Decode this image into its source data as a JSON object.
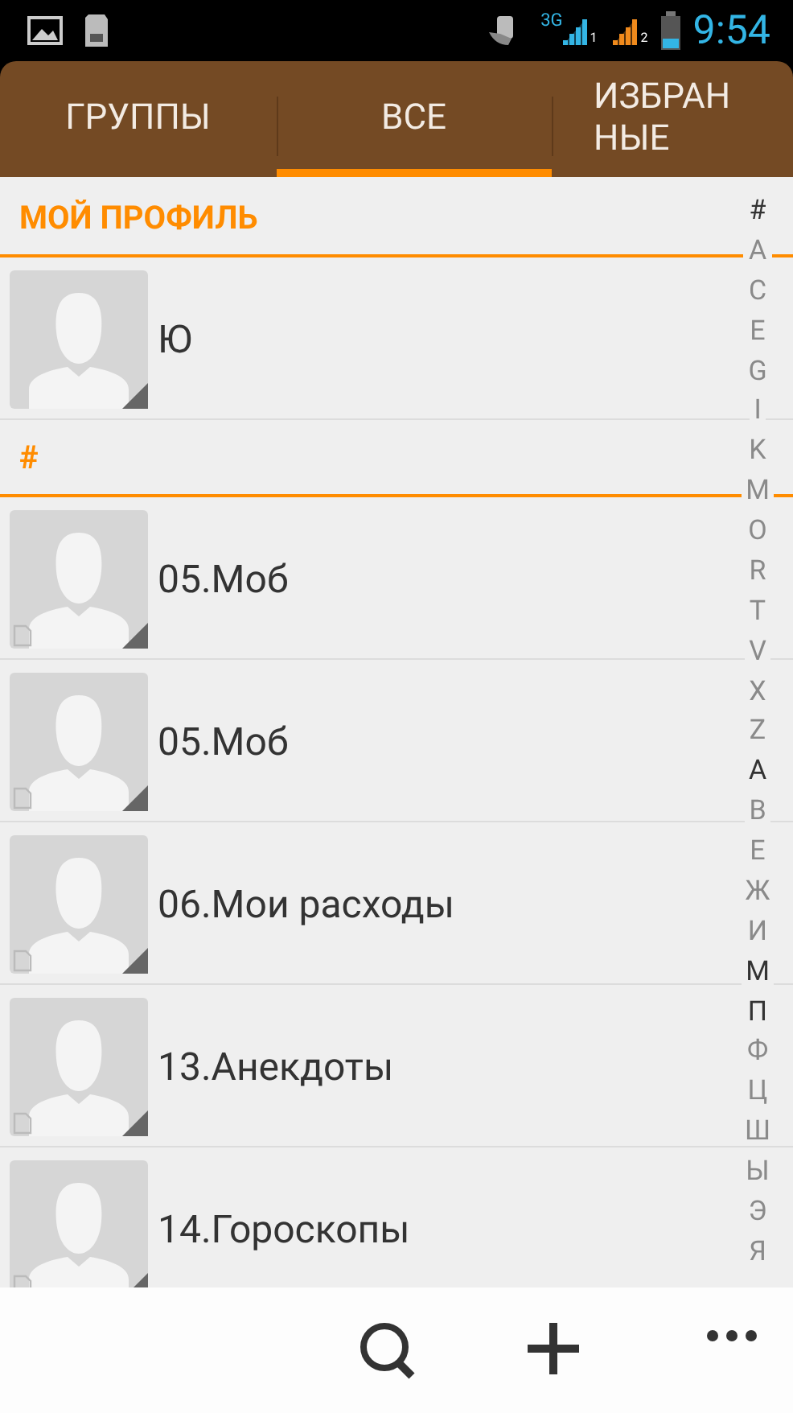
{
  "status_bar": {
    "network": "3G",
    "signals": [
      {
        "sim": "1",
        "color": "#33b5e5"
      },
      {
        "sim": "2",
        "color": "#f08a1c"
      }
    ],
    "time": "9:54"
  },
  "tabs": [
    {
      "label": "ГРУППЫ",
      "selected": false
    },
    {
      "label": "ВСЕ",
      "selected": true
    },
    {
      "label": "ИЗБРАН НЫЕ",
      "selected": false
    }
  ],
  "sections": [
    {
      "title": "МОЙ ПРОФИЛЬ",
      "contacts": [
        {
          "name": "Ю",
          "sim_badge": false
        }
      ]
    },
    {
      "title": "#",
      "contacts": [
        {
          "name": "05.Моб",
          "sim_badge": true
        },
        {
          "name": "05.Моб",
          "sim_badge": true
        },
        {
          "name": "06.Мои расходы",
          "sim_badge": true
        },
        {
          "name": "13.Анекдоты",
          "sim_badge": true
        },
        {
          "name": "14.Гороскопы",
          "sim_badge": true
        }
      ]
    }
  ],
  "index": [
    {
      "letter": "#",
      "active": true
    },
    {
      "letter": "A",
      "active": false
    },
    {
      "letter": "C",
      "active": false
    },
    {
      "letter": "E",
      "active": false
    },
    {
      "letter": "G",
      "active": false
    },
    {
      "letter": "I",
      "active": false
    },
    {
      "letter": "K",
      "active": false
    },
    {
      "letter": "M",
      "active": false
    },
    {
      "letter": "O",
      "active": false
    },
    {
      "letter": "R",
      "active": false
    },
    {
      "letter": "T",
      "active": false
    },
    {
      "letter": "V",
      "active": false
    },
    {
      "letter": "X",
      "active": false
    },
    {
      "letter": "Z",
      "active": false
    },
    {
      "letter": "А",
      "active": true
    },
    {
      "letter": "В",
      "active": false
    },
    {
      "letter": "Е",
      "active": false
    },
    {
      "letter": "Ж",
      "active": false
    },
    {
      "letter": "И",
      "active": false
    },
    {
      "letter": "М",
      "active": true
    },
    {
      "letter": "П",
      "active": true
    },
    {
      "letter": "Ф",
      "active": false
    },
    {
      "letter": "Ц",
      "active": false
    },
    {
      "letter": "Ш",
      "active": false
    },
    {
      "letter": "Ы",
      "active": false
    },
    {
      "letter": "Э",
      "active": false
    },
    {
      "letter": "Я",
      "active": false
    }
  ],
  "bottom_bar": {
    "actions": [
      {
        "kind": "search"
      },
      {
        "kind": "add"
      },
      {
        "kind": "more"
      }
    ]
  }
}
